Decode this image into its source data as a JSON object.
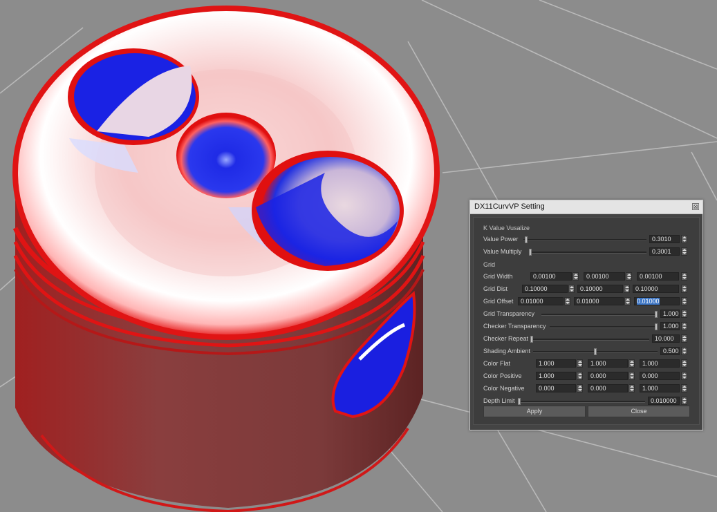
{
  "dialog": {
    "title": "DX11CurvVP Setting",
    "close_glyph": "⊠",
    "close_icon": "close-icon"
  },
  "sections": {
    "k_value": "K Value Vusalize",
    "grid": "Grid"
  },
  "rows": {
    "value_power": {
      "label": "Value Power",
      "value": "0.3010",
      "slider_fraction": 0.01
    },
    "value_multiply": {
      "label": "Value Multiply",
      "value": "0.3001",
      "slider_fraction": 0.0
    },
    "grid_width": {
      "label": "Grid Width",
      "values": [
        "0.00100",
        "0.00100",
        "0.00100"
      ]
    },
    "grid_dist": {
      "label": "Grid Dist",
      "values": [
        "0.10000",
        "0.10000",
        "0.10000"
      ]
    },
    "grid_offset": {
      "label": "Grid Offset",
      "values": [
        "0.01000",
        "0.01000",
        "0.01000"
      ],
      "selected_index": 2
    },
    "grid_transparency": {
      "label": "Grid Transparency",
      "value": "1.000",
      "slider_fraction": 1.0
    },
    "checker_transparency": {
      "label": "Checker Transparency",
      "value": "1.000",
      "slider_fraction": 1.0
    },
    "checker_repeat": {
      "label": "Checker Repeat",
      "value": "10.000",
      "slider_fraction": 0.0
    },
    "shading_ambient": {
      "label": "Shading Ambient",
      "value": "0.500",
      "slider_fraction": 0.5
    },
    "color_flat": {
      "label": "Color Flat",
      "values": [
        "1.000",
        "1.000",
        "1.000"
      ]
    },
    "color_positive": {
      "label": "Color Positive",
      "values": [
        "1.000",
        "0.000",
        "0.000"
      ]
    },
    "color_negative": {
      "label": "Color Negative",
      "values": [
        "0.000",
        "0.000",
        "1.000"
      ]
    },
    "depth_limit": {
      "label": "Depth Limit",
      "value": "0.010000",
      "slider_fraction": 0.0
    }
  },
  "buttons": {
    "apply": "Apply",
    "close": "Close"
  },
  "colors": {
    "positive": "#e8141a",
    "negative": "#1416e0",
    "flat": "#ffffff",
    "body": "#8a3c3c",
    "floor": "#8c8c8c",
    "selection": "#3a74c4"
  }
}
